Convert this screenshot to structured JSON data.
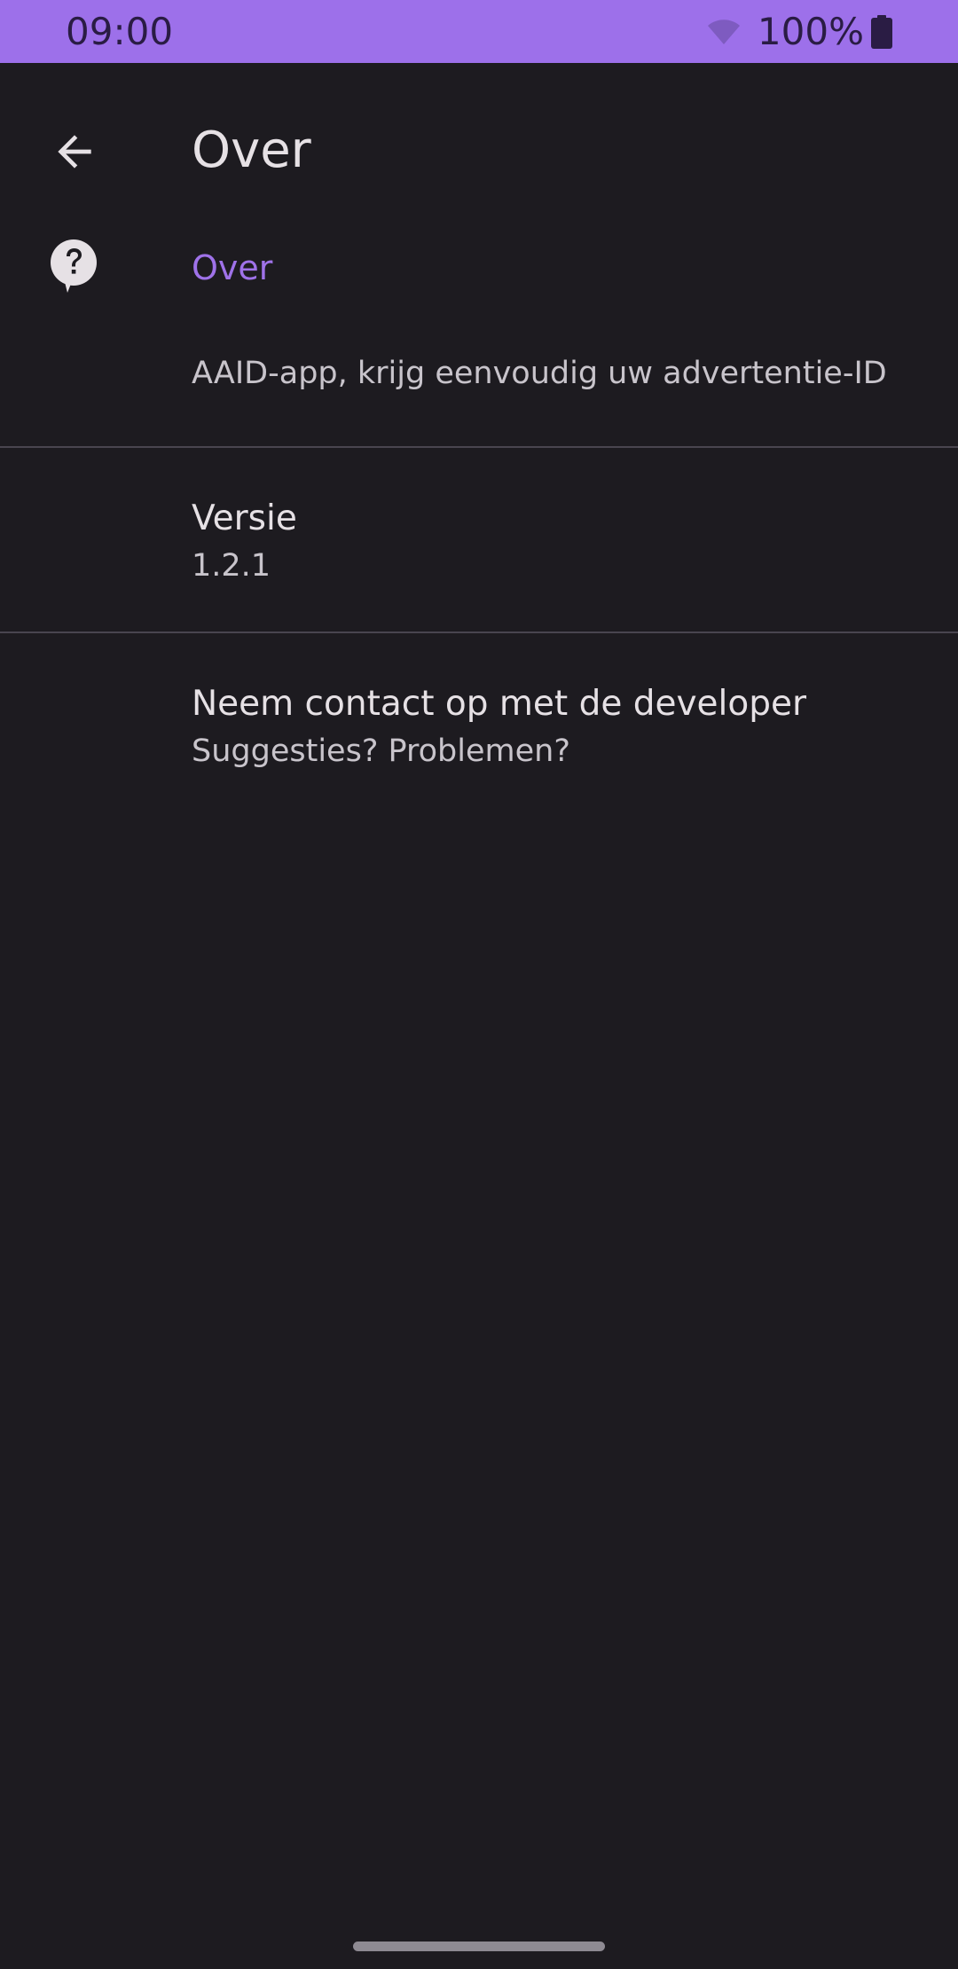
{
  "status_bar": {
    "time": "09:00",
    "battery": "100%",
    "icons": [
      "wifi-icon",
      "battery-icon"
    ]
  },
  "app_bar": {
    "back_icon": "arrow-back-icon",
    "title": "Over"
  },
  "about_section": {
    "icon": "help-icon",
    "title": "Over",
    "description": "AAID-app, krijg eenvoudig uw advertentie-ID"
  },
  "version": {
    "title": "Versie",
    "value": "1.2.1"
  },
  "contact": {
    "title": "Neem contact op met de developer",
    "summary": "Suggesties? Problemen?"
  },
  "colors": {
    "status_bar": "#9d70ea",
    "background": "#1d1b20",
    "accent": "#9f72e9",
    "text_primary": "#e6e1e5",
    "text_secondary": "#c8c4cb",
    "divider": "#49454f"
  }
}
